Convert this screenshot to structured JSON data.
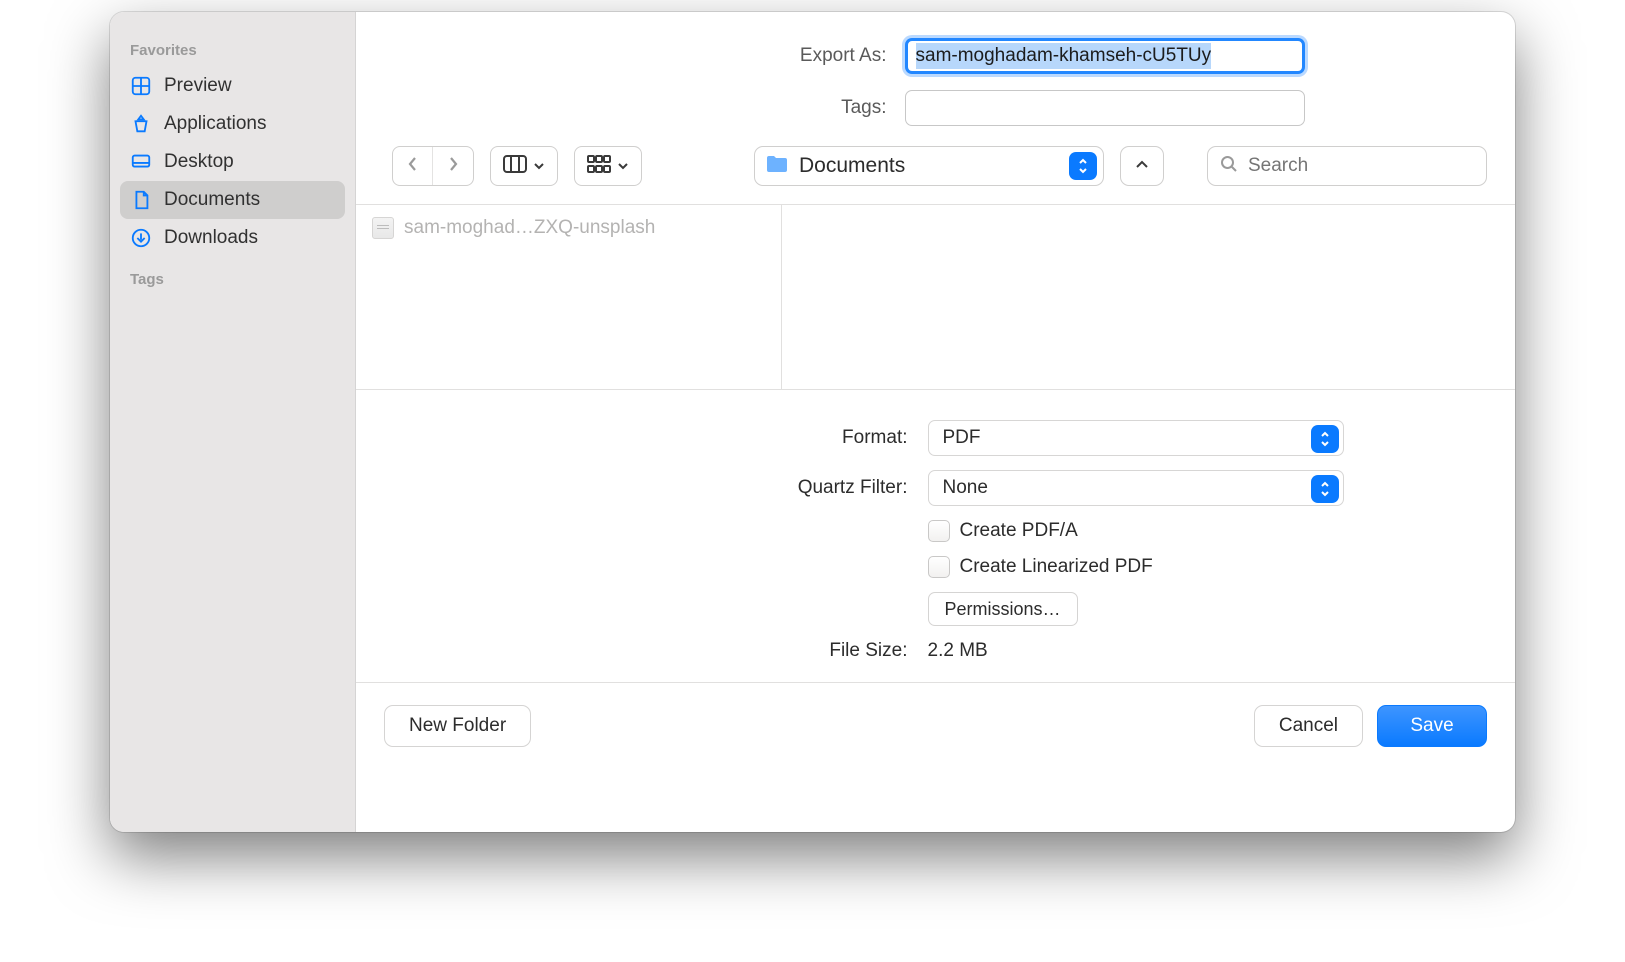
{
  "sidebar": {
    "heading_favorites": "Favorites",
    "heading_tags": "Tags",
    "items": [
      {
        "label": "Preview",
        "icon": "grid"
      },
      {
        "label": "Applications",
        "icon": "apps"
      },
      {
        "label": "Desktop",
        "icon": "desktop"
      },
      {
        "label": "Documents",
        "icon": "doc",
        "selected": true
      },
      {
        "label": "Downloads",
        "icon": "download"
      }
    ]
  },
  "form": {
    "export_label": "Export As:",
    "export_value": "sam-moghadam-khamseh-cU5TUy",
    "tags_label": "Tags:",
    "tags_value": ""
  },
  "toolbar": {
    "location_label": "Documents",
    "search_placeholder": "Search"
  },
  "browser": {
    "files": [
      {
        "name": "sam-moghad…ZXQ-unsplash"
      }
    ]
  },
  "options": {
    "format_label": "Format:",
    "format_value": "PDF",
    "quartz_label": "Quartz Filter:",
    "quartz_value": "None",
    "pdfa_label": "Create PDF/A",
    "linearized_label": "Create Linearized PDF",
    "permissions_label": "Permissions…",
    "file_size_label": "File Size:",
    "file_size_value": "2.2 MB"
  },
  "footer": {
    "new_folder": "New Folder",
    "cancel": "Cancel",
    "save": "Save"
  }
}
